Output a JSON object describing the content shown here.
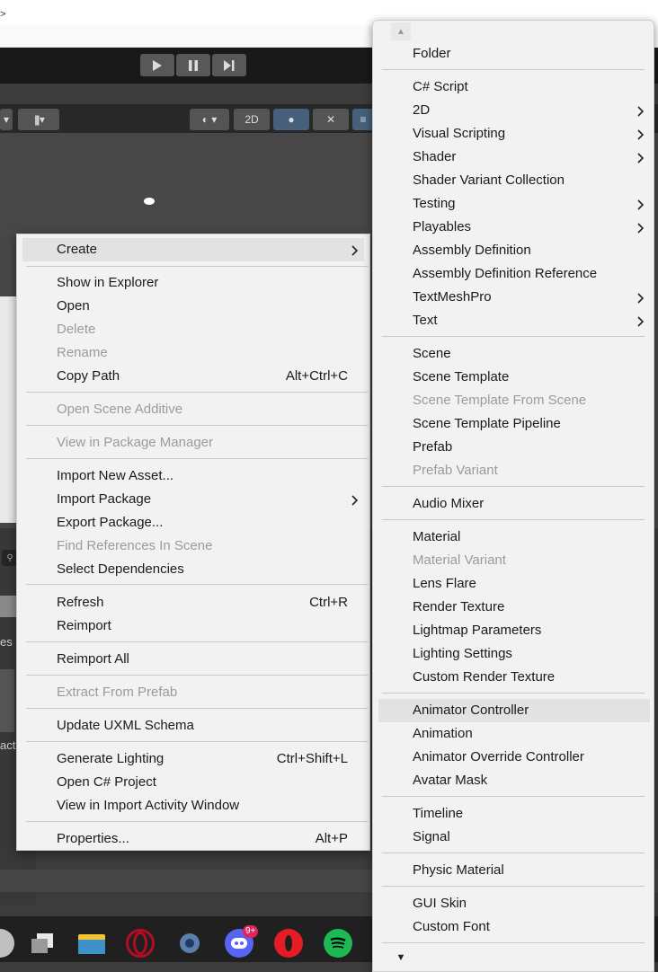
{
  "create_menu": {
    "items": [
      {
        "label": "Create",
        "shortcut": "",
        "disabled": false,
        "submenu": true
      },
      {
        "label": "Show in Explorer",
        "shortcut": "",
        "disabled": false,
        "submenu": false
      },
      {
        "label": "Open",
        "shortcut": "",
        "disabled": false,
        "submenu": false
      },
      {
        "label": "Delete",
        "shortcut": "",
        "disabled": true,
        "submenu": false
      },
      {
        "label": "Rename",
        "shortcut": "",
        "disabled": true,
        "submenu": false
      },
      {
        "label": "Copy Path",
        "shortcut": "Alt+Ctrl+C",
        "disabled": false,
        "submenu": false
      },
      {
        "label": "Open Scene Additive",
        "shortcut": "",
        "disabled": true,
        "submenu": false
      },
      {
        "label": "View in Package Manager",
        "shortcut": "",
        "disabled": true,
        "submenu": false
      },
      {
        "label": "Import New Asset...",
        "shortcut": "",
        "disabled": false,
        "submenu": false
      },
      {
        "label": "Import Package",
        "shortcut": "",
        "disabled": false,
        "submenu": true
      },
      {
        "label": "Export Package...",
        "shortcut": "",
        "disabled": false,
        "submenu": false
      },
      {
        "label": "Find References In Scene",
        "shortcut": "",
        "disabled": true,
        "submenu": false
      },
      {
        "label": "Select Dependencies",
        "shortcut": "",
        "disabled": false,
        "submenu": false
      },
      {
        "label": "Refresh",
        "shortcut": "Ctrl+R",
        "disabled": false,
        "submenu": false
      },
      {
        "label": "Reimport",
        "shortcut": "",
        "disabled": false,
        "submenu": false
      },
      {
        "label": "Reimport All",
        "shortcut": "",
        "disabled": false,
        "submenu": false
      },
      {
        "label": "Extract From Prefab",
        "shortcut": "",
        "disabled": true,
        "submenu": false
      },
      {
        "label": "Update UXML Schema",
        "shortcut": "",
        "disabled": false,
        "submenu": false
      },
      {
        "label": "Generate Lighting",
        "shortcut": "Ctrl+Shift+L",
        "disabled": false,
        "submenu": false
      },
      {
        "label": "Open C# Project",
        "shortcut": "",
        "disabled": false,
        "submenu": false
      },
      {
        "label": "View in Import Activity Window",
        "shortcut": "",
        "disabled": false,
        "submenu": false
      },
      {
        "label": "Properties...",
        "shortcut": "Alt+P",
        "disabled": false,
        "submenu": false
      }
    ]
  },
  "create_submenu": {
    "items": [
      {
        "label": "Folder",
        "disabled": false,
        "submenu": false
      },
      {
        "label": "C# Script",
        "disabled": false,
        "submenu": false
      },
      {
        "label": "2D",
        "disabled": false,
        "submenu": true
      },
      {
        "label": "Visual Scripting",
        "disabled": false,
        "submenu": true
      },
      {
        "label": "Shader",
        "disabled": false,
        "submenu": true
      },
      {
        "label": "Shader Variant Collection",
        "disabled": false,
        "submenu": false
      },
      {
        "label": "Testing",
        "disabled": false,
        "submenu": true
      },
      {
        "label": "Playables",
        "disabled": false,
        "submenu": true
      },
      {
        "label": "Assembly Definition",
        "disabled": false,
        "submenu": false
      },
      {
        "label": "Assembly Definition Reference",
        "disabled": false,
        "submenu": false
      },
      {
        "label": "TextMeshPro",
        "disabled": false,
        "submenu": true
      },
      {
        "label": "Text",
        "disabled": false,
        "submenu": true
      },
      {
        "label": "Scene",
        "disabled": false,
        "submenu": false
      },
      {
        "label": "Scene Template",
        "disabled": false,
        "submenu": false
      },
      {
        "label": "Scene Template From Scene",
        "disabled": true,
        "submenu": false
      },
      {
        "label": "Scene Template Pipeline",
        "disabled": false,
        "submenu": false
      },
      {
        "label": "Prefab",
        "disabled": false,
        "submenu": false
      },
      {
        "label": "Prefab Variant",
        "disabled": true,
        "submenu": false
      },
      {
        "label": "Audio Mixer",
        "disabled": false,
        "submenu": false
      },
      {
        "label": "Material",
        "disabled": false,
        "submenu": false
      },
      {
        "label": "Material Variant",
        "disabled": true,
        "submenu": false
      },
      {
        "label": "Lens Flare",
        "disabled": false,
        "submenu": false
      },
      {
        "label": "Render Texture",
        "disabled": false,
        "submenu": false
      },
      {
        "label": "Lightmap Parameters",
        "disabled": false,
        "submenu": false
      },
      {
        "label": "Lighting Settings",
        "disabled": false,
        "submenu": false
      },
      {
        "label": "Custom Render Texture",
        "disabled": false,
        "submenu": false
      },
      {
        "label": "Animator Controller",
        "disabled": false,
        "submenu": false
      },
      {
        "label": "Animation",
        "disabled": false,
        "submenu": false
      },
      {
        "label": "Animator Override Controller",
        "disabled": false,
        "submenu": false
      },
      {
        "label": "Avatar Mask",
        "disabled": false,
        "submenu": false
      },
      {
        "label": "Timeline",
        "disabled": false,
        "submenu": false
      },
      {
        "label": "Signal",
        "disabled": false,
        "submenu": false
      },
      {
        "label": "Physic Material",
        "disabled": false,
        "submenu": false
      },
      {
        "label": "GUI Skin",
        "disabled": false,
        "submenu": false
      },
      {
        "label": "Custom Font",
        "disabled": false,
        "submenu": false
      }
    ]
  },
  "scene_toolbar": {
    "mode_2d_label": "2D"
  },
  "taskbar": {
    "discord_badge": "9+"
  },
  "background_fragments": {
    "es": "es",
    "act": "act"
  },
  "icons": {
    "play": "play-icon",
    "pause": "pause-icon",
    "step": "step-icon",
    "scroll_up": "scroll-up-arrow-icon",
    "scroll_down": "scroll-down-arrow-icon",
    "submenu_arrow": "chevron-right-icon"
  },
  "colors": {
    "menu_bg": "#f2f2f2",
    "disabled_text": "#9b9b9b",
    "highlight": "#e2e2e2",
    "toolbar_active": "#46607c"
  }
}
